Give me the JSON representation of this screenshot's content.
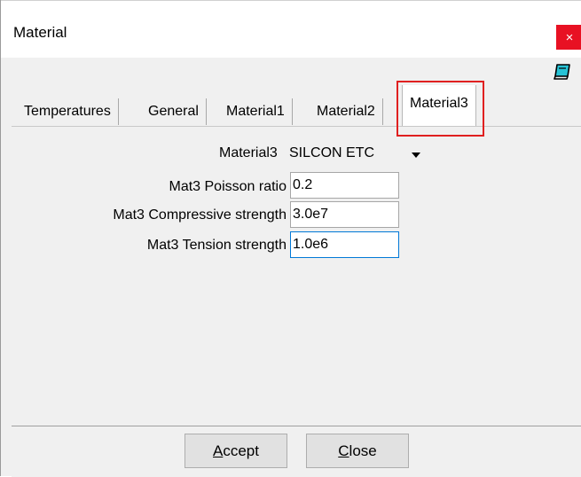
{
  "window": {
    "title": "Material",
    "close_glyph": "×",
    "help_icon": "help-book-icon"
  },
  "tabs": [
    {
      "label": "Temperatures",
      "active": false
    },
    {
      "label": "General",
      "active": false
    },
    {
      "label": "Material1",
      "active": false
    },
    {
      "label": "Material2",
      "active": false
    },
    {
      "label": "Material3",
      "active": true
    }
  ],
  "form": {
    "material": {
      "label": "Material3",
      "value": "SILCON ETC"
    },
    "poisson": {
      "label": "Mat3 Poisson ratio",
      "value": "0.2"
    },
    "compressive": {
      "label": "Mat3 Compressive strength",
      "value": "3.0e7"
    },
    "tension": {
      "label": "Mat3 Tension strength",
      "value": "1.0e6"
    }
  },
  "buttons": {
    "accept": {
      "first": "A",
      "rest": "ccept"
    },
    "close": {
      "first": "C",
      "rest": "lose"
    }
  },
  "colors": {
    "highlight": "#e02020",
    "close_button": "#e81123",
    "focus_border": "#0078d7"
  }
}
